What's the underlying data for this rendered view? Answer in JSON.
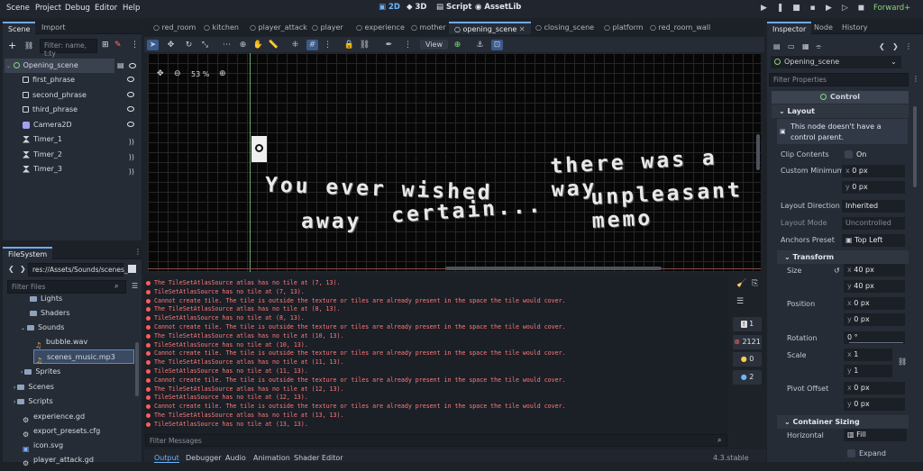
{
  "menus": [
    "Scene",
    "Project",
    "Debug",
    "Editor",
    "Help"
  ],
  "modes": [
    "2D",
    "3D",
    "Script",
    "AssetLib"
  ],
  "renderer": "Forward+",
  "scene_panel": {
    "tabs": [
      "Scene",
      "Import"
    ],
    "filter_placeholder": "Filter: name, t:ty",
    "nodes": [
      "Opening_scene",
      "first_phrase",
      "second_phrase",
      "third_phrase",
      "Camera2D",
      "Timer_1",
      "Timer_2",
      "Timer_3"
    ]
  },
  "filesystem": {
    "title": "FileSystem",
    "path": "res://Assets/Sounds/scenes_",
    "filter_placeholder": "Filter Files",
    "items": [
      "Lights",
      "Shaders",
      "Sounds",
      "bubble.wav",
      "scenes_music.mp3",
      "Sprites",
      "Scenes",
      "Scripts",
      "experience.gd",
      "export_presets.cfg",
      "icon.svg",
      "player_attack.gd"
    ]
  },
  "editor_tabs": [
    "red_room",
    "kitchen",
    "player_attack",
    "player",
    "experience",
    "mother",
    "opening_scene",
    "closing_scene",
    "platform",
    "red_room_wall"
  ],
  "view_label": "View",
  "zoom": "53 %",
  "canvas_text": {
    "line1": "there was a way",
    "line2a": "You ever wished",
    "line2b": "unpleasant memo",
    "line2mid": "certain...",
    "line3a": "away"
  },
  "console": {
    "lines": [
      "The TileSetAtlasSource atlas has no tile at (7, 13).",
      "TileSetAtlasSource has no tile at (7, 13).",
      "Cannot create tile. The tile is outside the texture or tiles are already present in the space the tile would cover.",
      "The TileSetAtlasSource atlas has no tile at (8, 13).",
      "TileSetAtlasSource has no tile at (8, 13).",
      "Cannot create tile. The tile is outside the texture or tiles are already present in the space the tile would cover.",
      "The TileSetAtlasSource atlas has no tile at (10, 13).",
      "TileSetAtlasSource has no tile at (10, 13).",
      "Cannot create tile. The tile is outside the texture or tiles are already present in the space the tile would cover.",
      "The TileSetAtlasSource atlas has no tile at (11, 13).",
      "TileSetAtlasSource has no tile at (11, 13).",
      "Cannot create tile. The tile is outside the texture or tiles are already present in the space the tile would cover.",
      "The TileSetAtlasSource atlas has no tile at (12, 13).",
      "TileSetAtlasSource has no tile at (12, 13).",
      "Cannot create tile. The tile is outside the texture or tiles are already present in the space the tile would cover.",
      "The TileSetAtlasSource atlas has no tile at (13, 13).",
      "TileSetAtlasSource has no tile at (13, 13)."
    ],
    "filter_placeholder": "Filter Messages",
    "counts": {
      "info": "1",
      "errors": "2121",
      "warnings": "0",
      "messages": "2"
    },
    "bottom_tabs": [
      "Output",
      "Debugger",
      "Audio",
      "Animation",
      "Shader Editor"
    ],
    "version": "4.3.stable"
  },
  "inspector": {
    "tabs": [
      "Inspector",
      "Node",
      "History"
    ],
    "node": "Opening_scene",
    "filter": "Filter Properties",
    "class": "Control",
    "layout": "Layout",
    "warning": "This node doesn't have a control parent.",
    "clip_contents": "Clip Contents",
    "clip_on": "On",
    "custom_min": "Custom Minimum",
    "cm_x": "0 px",
    "cm_y": "0 px",
    "layout_dir": "Layout Direction",
    "layout_dir_val": "Inherited",
    "layout_mode": "Layout Mode",
    "layout_mode_val": "Uncontrolled",
    "anchors": "Anchors Preset",
    "anchors_val": "Top Left",
    "transform": "Transform",
    "size": "Size",
    "size_x": "40 px",
    "size_y": "40 px",
    "position": "Position",
    "pos_x": "0 px",
    "pos_y": "0 px",
    "rotation": "Rotation",
    "rotation_val": "0 °",
    "scale": "Scale",
    "scale_x": "1",
    "scale_y": "1",
    "pivot": "Pivot Offset",
    "pivot_x": "0 px",
    "pivot_y": "0 px",
    "container": "Container Sizing",
    "horizontal": "Horizontal",
    "horizontal_val": "Fill",
    "expand": "Expand"
  }
}
